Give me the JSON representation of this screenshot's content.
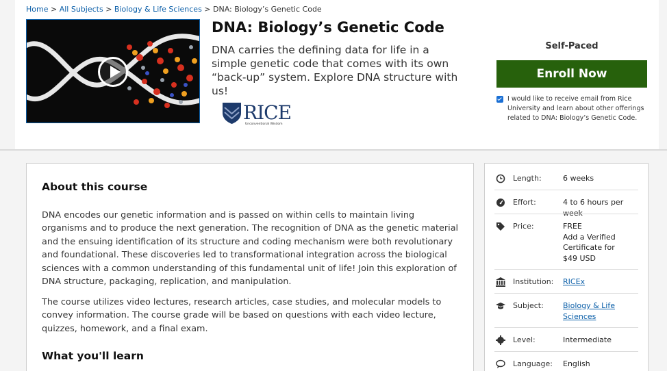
{
  "breadcrumb": {
    "items": [
      "Home",
      "All Subjects",
      "Biology & Life Sciences"
    ],
    "current": "DNA: Biology’s Genetic Code",
    "separator": ">"
  },
  "course": {
    "title": "DNA: Biology’s Genetic Code",
    "subtitle": "DNA carries the defining data for life in a simple genetic code that comes with its own “back-up” system. Explore DNA structure with us!",
    "video_icon": "play-icon"
  },
  "institution_logo": {
    "wordmark": "RICE",
    "tagline": "Unconventional Wisdom",
    "shield_color": "#1d3a6b"
  },
  "enroll": {
    "pacing": "Self-Paced",
    "button_label": "Enroll Now",
    "button_color": "#27610c",
    "optin_checked": true,
    "optin_text": "I would like to receive email from Rice University and learn about other offerings related to DNA: Biology’s Genetic Code."
  },
  "about": {
    "heading": "About this course",
    "paragraphs": [
      "DNA encodes our genetic information and is passed on within cells to maintain living organisms and to produce the next generation. The recognition of DNA as the genetic material and the ensuing identification of its structure and coding mechanism were both revolutionary and foundational. These discoveries led to transformational integration across the biological sciences with a common understanding of this fundamental unit of life! Join this exploration of DNA structure, packaging, replication, and manipulation.",
      "The course utilizes video lectures, research articles, case studies, and molecular models to convey information. The course grade will be based on questions with each video lecture, quizzes, homework, and a final exam."
    ],
    "learn_heading": "What you'll learn"
  },
  "facts": [
    {
      "icon": "clock-icon",
      "label": "Length:",
      "value": "6 weeks",
      "link": false
    },
    {
      "icon": "gauge-icon",
      "label": "Effort:",
      "value": "4 to 6 hours per week",
      "link": false
    },
    {
      "icon": "tag-icon",
      "label": "Price:",
      "value": "FREE\nAdd a Verified Certificate for $49 USD",
      "link": false
    },
    {
      "icon": "institution-icon",
      "label": "Institution:",
      "value": "RICEx",
      "link": true
    },
    {
      "icon": "graduation-cap-icon",
      "label": "Subject:",
      "value": "Biology & Life Sciences",
      "link": true
    },
    {
      "icon": "level-icon",
      "label": "Level:",
      "value": "Intermediate",
      "link": false
    },
    {
      "icon": "language-icon",
      "label": "Language:",
      "value": "English",
      "link": false
    }
  ]
}
